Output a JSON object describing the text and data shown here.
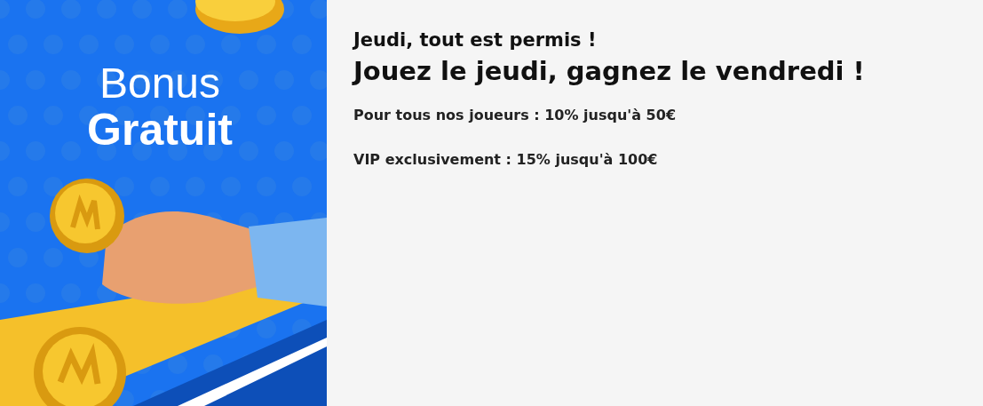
{
  "banner": {
    "title_lines": [
      "Bonus",
      "Gratuit"
    ]
  },
  "promo": {
    "kicker": "Jeudi, tout est permis !",
    "heading": "Jouez le jeudi, gagnez le vendredi !",
    "offers": [
      "Pour tous nos joueurs : 10% jusqu'à 50€",
      "VIP exclusivement : 15% jusqu'à 100€"
    ]
  }
}
